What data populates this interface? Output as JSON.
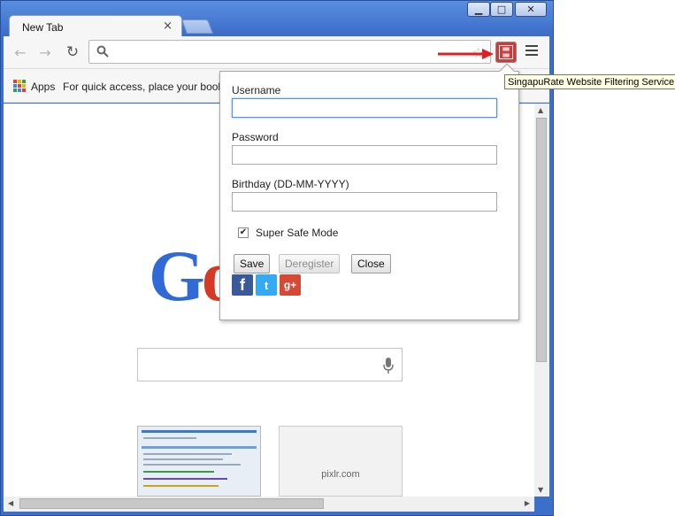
{
  "window": {
    "caption_min": "▁",
    "caption_max": "□",
    "caption_close": "✕"
  },
  "tab": {
    "title": "New Tab",
    "close": "×"
  },
  "toolbar": {
    "back": "←",
    "forward": "→",
    "reload": "↻",
    "omnibox_value": "",
    "star": "☆",
    "extension_tooltip": "SingapuRate Website Filtering Service",
    "extension_icon": "singapurate-icon",
    "menu_icon": "menu-icon"
  },
  "bookmarks": {
    "apps_label": "Apps",
    "hint": "For quick access, place your bookmar",
    "apps_colors": [
      "#e34133",
      "#f5b400",
      "#2fa44f",
      "#4285f4",
      "#e34133",
      "#f5b400",
      "#2fa44f",
      "#4285f4",
      "#e34133"
    ]
  },
  "newtab_page": {
    "logo_g": "G",
    "logo_o": "o",
    "thumb2_label": "pixlr.com"
  },
  "popup": {
    "username_label": "Username",
    "username_value": "",
    "password_label": "Password",
    "password_value": "",
    "birthday_label": "Birthday (DD-MM-YYYY)",
    "birthday_value": "",
    "super_safe_label": "Super Safe Mode",
    "super_safe_checked": true,
    "checkmark": "✔",
    "save_label": "Save",
    "deregister_label": "Deregister",
    "close_label": "Close",
    "social": {
      "facebook": "f",
      "twitter": "t",
      "googleplus": "g+"
    }
  },
  "colors": {
    "window_frame": "#3c6fc9",
    "extension_red": "#d23a3a",
    "arrow_red": "#e02020",
    "google_blue": "#3169d6",
    "google_red": "#d53a26"
  }
}
